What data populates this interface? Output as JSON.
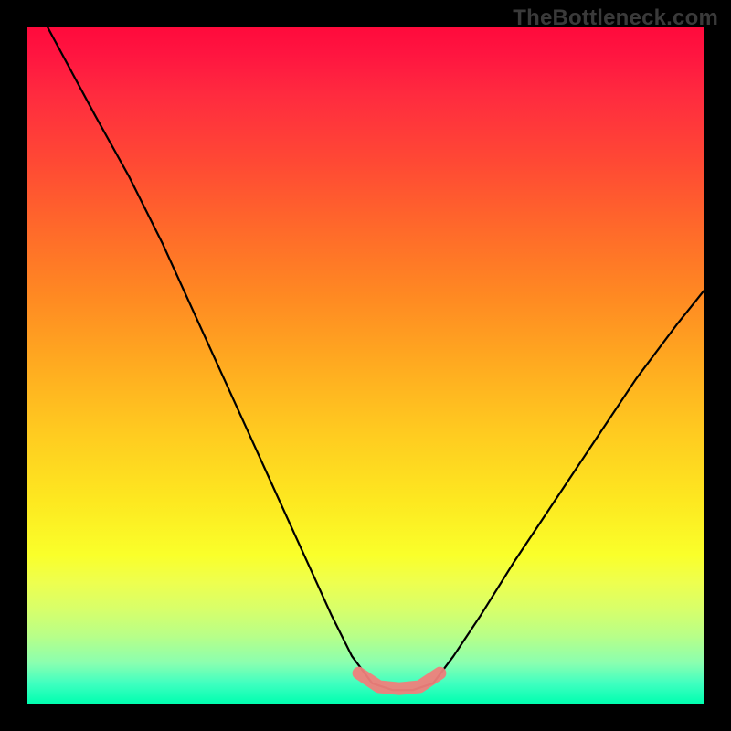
{
  "watermark": {
    "text": "TheBottleneck.com"
  },
  "chart_data": {
    "type": "line",
    "title": "",
    "xlabel": "",
    "ylabel": "",
    "xlim": [
      0,
      100
    ],
    "ylim": [
      0,
      100
    ],
    "grid": false,
    "notes": "Relative-valley curve on a red→green vertical gradient; axes unlabeled. x/y in 0–100 viewport units (0,0 top-left). Valley floor ~y=97 across x≈51–60; highlight is a coral overlay segment along the floor.",
    "series": [
      {
        "name": "curve",
        "color": "#000000",
        "x": [
          3,
          10,
          15,
          20,
          25,
          30,
          35,
          40,
          45,
          48,
          51,
          54,
          57,
          60,
          63,
          67,
          72,
          78,
          84,
          90,
          96,
          100
        ],
        "y": [
          0,
          13,
          22,
          32,
          43,
          54,
          65,
          76,
          87,
          93,
          97,
          98,
          98,
          97,
          93,
          87,
          79,
          70,
          61,
          52,
          44,
          39
        ]
      },
      {
        "name": "highlight-floor",
        "color": "#ef7f7b",
        "x": [
          49,
          52,
          55,
          58,
          61
        ],
        "y": [
          95.5,
          97.5,
          97.8,
          97.5,
          95.5
        ]
      }
    ],
    "gradient_stops": [
      {
        "pos": 0.0,
        "color": "#ff0a3c"
      },
      {
        "pos": 0.2,
        "color": "#ff4934"
      },
      {
        "pos": 0.4,
        "color": "#ff8a22"
      },
      {
        "pos": 0.6,
        "color": "#ffcb20"
      },
      {
        "pos": 0.8,
        "color": "#f5ff30"
      },
      {
        "pos": 1.0,
        "color": "#00ffb0"
      }
    ]
  }
}
